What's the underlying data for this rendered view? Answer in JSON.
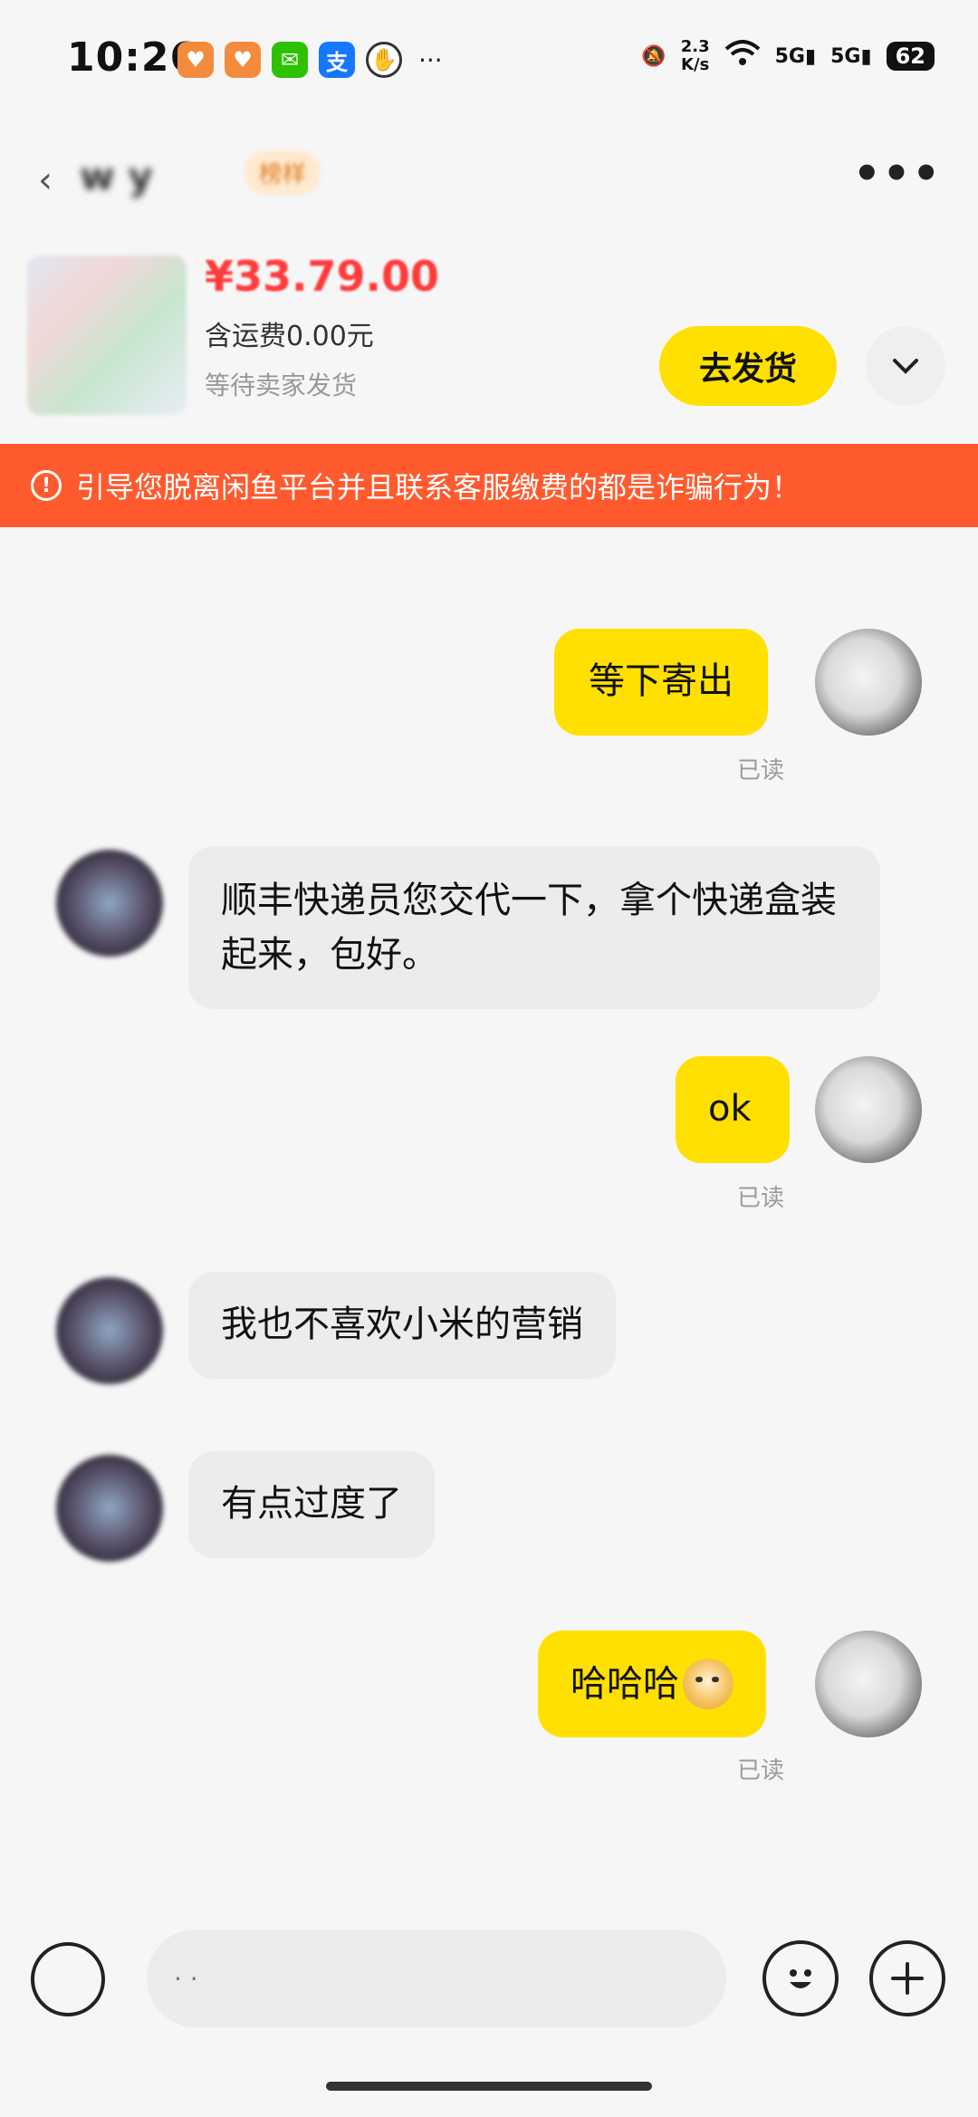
{
  "status_bar": {
    "time": "10:26",
    "net_speed_top": "2.3",
    "net_speed_bottom": "K/s",
    "sim1": "5G",
    "sim2": "5G",
    "battery": "62",
    "more": "···"
  },
  "nav": {
    "contact_name": "w y",
    "badge": "榜样",
    "more": "•••"
  },
  "product": {
    "price": "¥33.79.00",
    "shipping": "含运费0.00元",
    "status": "等待卖家发货",
    "ship_button": "去发货"
  },
  "warning": {
    "icon": "!",
    "text": "引导您脱离闲鱼平台并且联系客服缴费的都是诈骗行为！"
  },
  "messages": [
    {
      "sender": "me",
      "text": "等下寄出",
      "read": "已读"
    },
    {
      "sender": "them",
      "text": "顺丰快递员您交代一下，拿个快递盒装起来，包好。"
    },
    {
      "sender": "me",
      "text": "ok",
      "read": "已读"
    },
    {
      "sender": "them",
      "text": "我也不喜欢小米的营销"
    },
    {
      "sender": "them",
      "text": "有点过度了"
    },
    {
      "sender": "me",
      "text": "哈哈哈",
      "emoji": "doge-emoji",
      "read": "已读"
    }
  ],
  "input": {
    "placeholder": "· ·"
  },
  "colors": {
    "accent_yellow": "#ffe000",
    "warning_red": "#ff5a2e",
    "price_red": "#ff3b3b"
  }
}
